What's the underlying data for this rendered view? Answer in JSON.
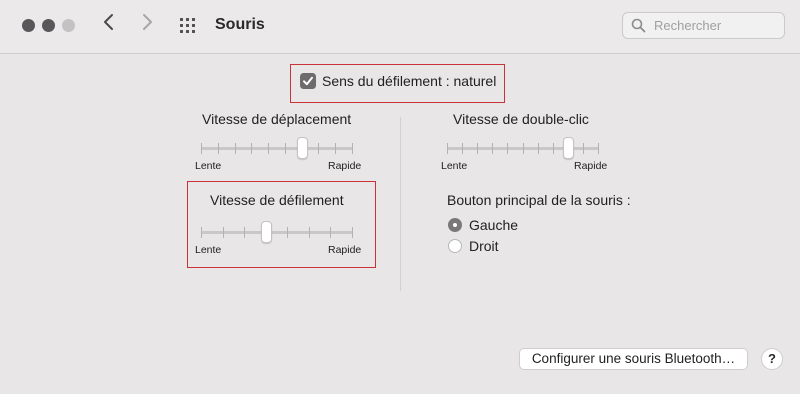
{
  "window": {
    "title": "Souris",
    "search_placeholder": "Rechercher"
  },
  "icons": {
    "back": "chevron-left-icon",
    "forward": "chevron-right-icon",
    "grid": "grid-icon",
    "search": "search-icon",
    "check": "checkmark-icon"
  },
  "natural_scroll": {
    "label": "Sens du défilement : naturel",
    "checked": true
  },
  "tracking_speed": {
    "title": "Vitesse de déplacement",
    "min_label": "Lente",
    "max_label": "Rapide",
    "value": 0.67
  },
  "scroll_speed": {
    "title": "Vitesse de défilement",
    "min_label": "Lente",
    "max_label": "Rapide",
    "value": 0.43
  },
  "double_click_speed": {
    "title": "Vitesse de double-clic",
    "min_label": "Lente",
    "max_label": "Rapide",
    "value": 0.8
  },
  "primary_button": {
    "title": "Bouton principal de la souris :",
    "options": [
      {
        "label": "Gauche",
        "selected": true
      },
      {
        "label": "Droit",
        "selected": false
      }
    ]
  },
  "footer": {
    "bluetooth_button": "Configurer une souris Bluetooth…",
    "help_button": "?"
  },
  "colors": {
    "highlight_box": "#c8333a",
    "background": "#e8e6e7"
  }
}
